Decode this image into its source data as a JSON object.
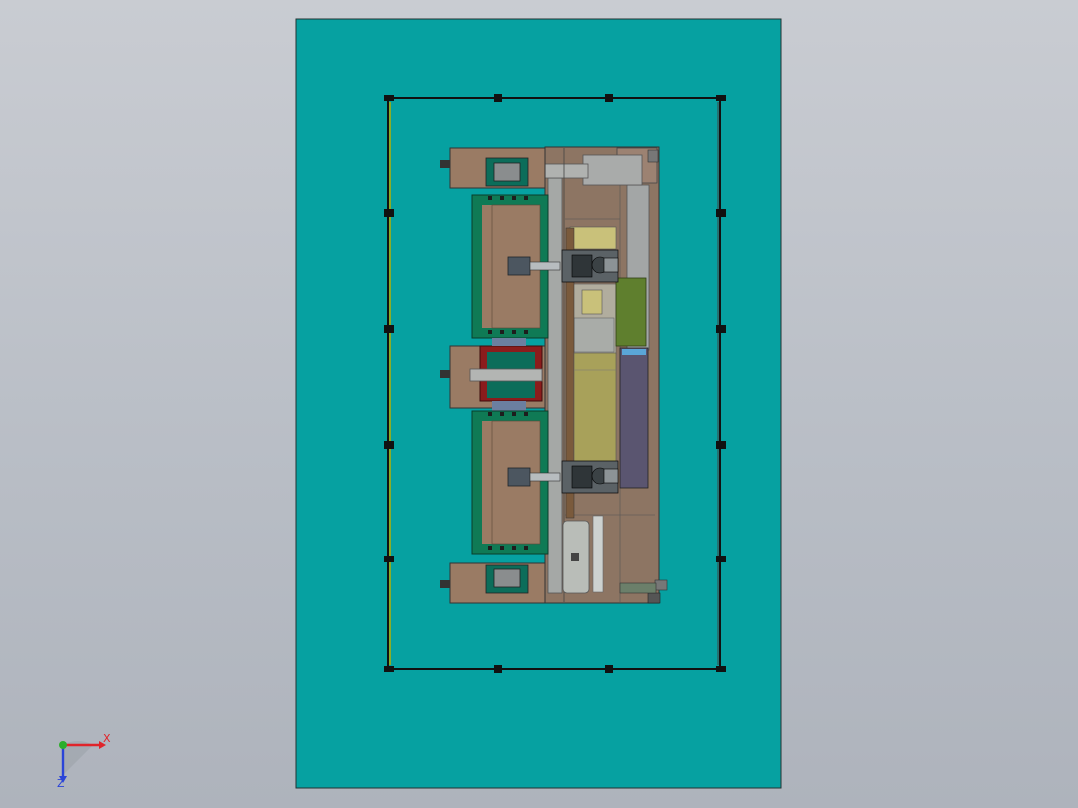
{
  "window": {
    "title": "",
    "view": "Top"
  },
  "colors": {
    "viewport_top": "#c9ccd2",
    "viewport_bottom": "#aeb3bc",
    "base_plate": "#06a1a1",
    "frame_line": "#111111",
    "frame_rail": "#b5b100",
    "wood_panel": "#9a7b64",
    "green_frame": "#0f7a55",
    "gray_part": "#a8aaa8",
    "yellow_part": "#a8a15a",
    "olive_part": "#5f7f2e",
    "purple_part": "#5a5570",
    "red_accent": "#8b1c1c",
    "axis_x": "#e0242a",
    "axis_y": "#2cae2c",
    "axis_z": "#2a44d8"
  },
  "model": {
    "name": "",
    "components": [
      "base-plate",
      "outer-frame",
      "machine-bed",
      "fixture-upper",
      "fixture-lower",
      "robot-upper",
      "robot-lower",
      "center-station",
      "gas-tank",
      "conveyor-column"
    ]
  },
  "triad": {
    "x_label": "X",
    "z_label": "Z"
  }
}
